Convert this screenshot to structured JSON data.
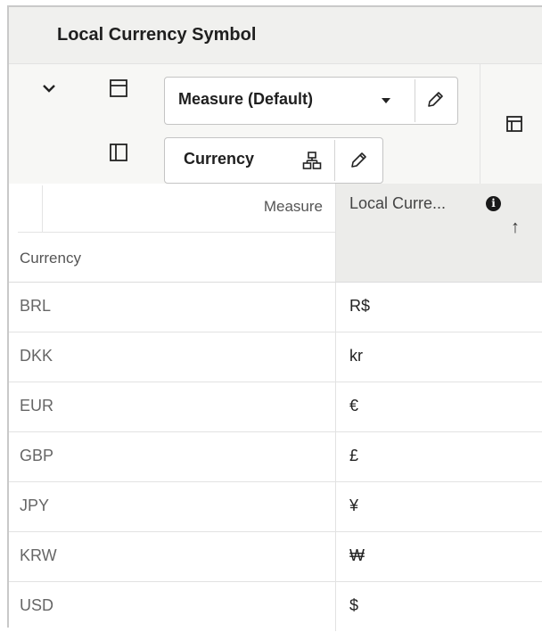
{
  "panel": {
    "title": "Local Currency Symbol"
  },
  "toolbar": {
    "rows_edge": {
      "label": "Measure (Default)"
    },
    "columns_edge": {
      "label": "Currency"
    }
  },
  "grid": {
    "measure_header": "Measure",
    "row_dimension_header": "Currency",
    "column_header": "Local Curre...",
    "sort_indicator": "↑",
    "rows": [
      {
        "currency": "BRL",
        "symbol": "R$"
      },
      {
        "currency": "DKK",
        "symbol": "kr"
      },
      {
        "currency": "EUR",
        "symbol": "€"
      },
      {
        "currency": "GBP",
        "symbol": "£"
      },
      {
        "currency": "JPY",
        "symbol": "¥"
      },
      {
        "currency": "KRW",
        "symbol": "₩"
      },
      {
        "currency": "USD",
        "symbol": "$"
      }
    ]
  }
}
